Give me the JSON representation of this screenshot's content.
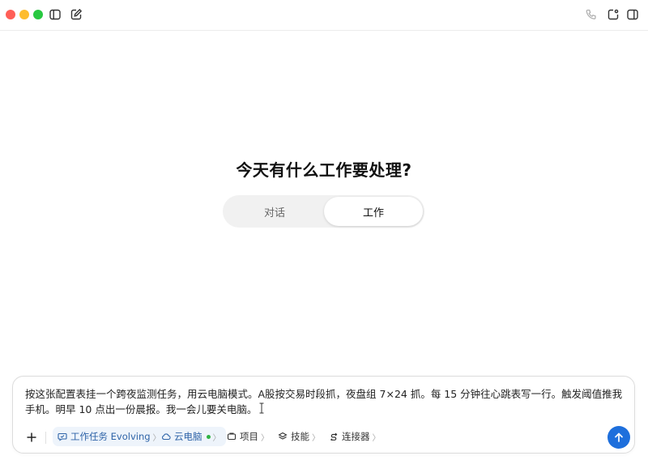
{
  "titlebar": {
    "icons": [
      "sidebar-toggle-icon",
      "compose-icon",
      "phone-icon",
      "new-window-icon",
      "panel-toggle-icon"
    ]
  },
  "main": {
    "headline": "今天有什么工作要处理?",
    "mode_tabs": [
      {
        "label": "对话",
        "active": false
      },
      {
        "label": "工作",
        "active": true
      }
    ]
  },
  "composer": {
    "text": "按这张配置表挂一个跨夜监测任务，用云电脑模式。A股按交易时段抓，夜盘组 7×24 抓。每 15 分钟往心跳表写一行。触发阈值推我手机。明早 10 点出一份晨报。我一会儿要关电脑。",
    "chips": [
      {
        "label": "工作任务 Evolving",
        "chevron": "〉",
        "icon": "task-chat-icon"
      },
      {
        "label": "云电脑",
        "chevron": "〉",
        "icon": "cloud-icon",
        "status": "online"
      },
      {
        "label": "项目",
        "chevron": "〉",
        "icon": "project-icon"
      },
      {
        "label": "技能",
        "chevron": "〉",
        "icon": "layers-icon"
      },
      {
        "label": "连接器",
        "chevron": "〉",
        "icon": "connector-icon"
      }
    ],
    "accent_color": "#1e6fdc"
  }
}
